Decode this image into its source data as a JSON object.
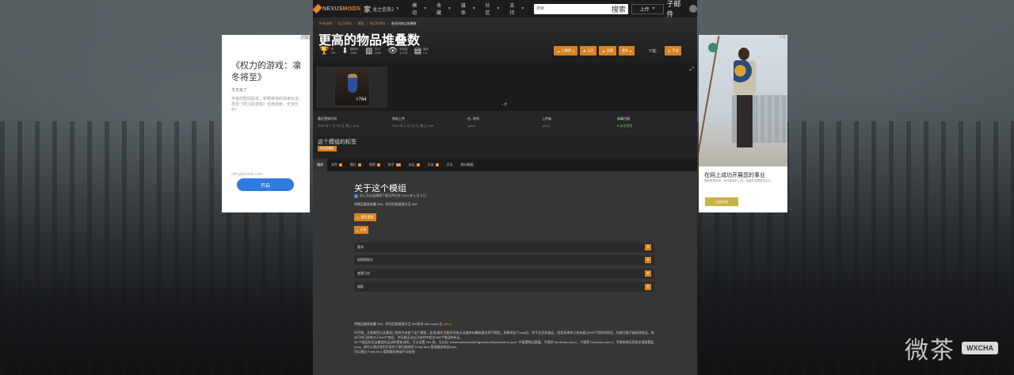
{
  "nav": {
    "logo_prefix": "NEXUS",
    "logo_suffix": "MODS",
    "game_icon": "家",
    "game_name": "龙之信条2",
    "items": [
      "模组",
      "收藏",
      "媒体",
      "社区",
      "支持"
    ],
    "search_placeholder": "搜索",
    "search_button": "搜索",
    "upload_label": "上传",
    "wx_label": "子邮件"
  },
  "mod": {
    "breadcrumb": [
      "所有游戏",
      "龙之信条2",
      "模组",
      "物品和库存",
      "更高的物品堆叠数"
    ],
    "title": "更高的物品堆叠数",
    "stats": [
      {
        "icon": "trophy-icon",
        "glyph": "🏆",
        "label": "赞",
        "value": "125"
      },
      {
        "icon": "download-icon",
        "glyph": "⬇",
        "label": "独特DL",
        "value": "4,960"
      },
      {
        "icon": "chart-icon",
        "glyph": "▥",
        "label": "总DL",
        "value": "4,800"
      },
      {
        "icon": "eye-icon",
        "glyph": "👁",
        "label": "浏览量",
        "value": "11,003"
      },
      {
        "icon": "version-icon",
        "glyph": "▤",
        "label": "版本",
        "value": "1.0"
      }
    ],
    "actions": {
      "track": "已跟踪",
      "endorse": "认可",
      "vote": "投票",
      "more": "更多",
      "download_label": "下载：",
      "manual": "手动"
    },
    "gallery_count": "1 件",
    "thumb_count": "×764",
    "info": [
      {
        "label": "最近更新时间",
        "value": "2024 年 3 月 26 日, 晚上 8:49"
      },
      {
        "label": "原始上传",
        "value": "2024 年 3 月 26 日, 晚上 8:49"
      },
      {
        "label": "由...制作",
        "value": "zydq1"
      },
      {
        "label": "上传者",
        "value": "zydq1"
      },
      {
        "label": "病毒扫描",
        "value": "安全使用"
      }
    ],
    "tags_title": "这个模组的标签",
    "tag_button": "标记此模组",
    "tabs": [
      {
        "label": "描述",
        "badge": ""
      },
      {
        "label": "文件",
        "badge": "1"
      },
      {
        "label": "图片",
        "badge": "1"
      },
      {
        "label": "视频",
        "badge": "0"
      },
      {
        "label": "帖子",
        "badge": "13"
      },
      {
        "label": "论坛",
        "badge": "0"
      },
      {
        "label": "日志",
        "badge": "0"
      },
      {
        "label": "日志",
        "badge": ""
      },
      {
        "label": "统计数据",
        "badge": ""
      }
    ]
  },
  "desc": {
    "title": "关于这个模组",
    "meta": "自上次从此模组下载文件后在 2024 年 4 月 3 日",
    "summary": "将物品最高堆叠 999，将项目数量提升至 999",
    "btn_requirements": "报告滥用",
    "btn_share": "分享",
    "accordion": [
      "要求",
      "权限和积分",
      "变更日志",
      "捐款"
    ],
    "body_1a": "将物品最高堆叠 999，将项目数量提升至 999所有 dd2 mods 在",
    "body_1b": "github",
    "body_2": "中开版。注意事项以及事项1 游戏中安装了这个模组，此项/操作可能的导致无法使库存叠装量仍然不稳定。如果你这个mod后，你不会丢失物品，但是如果你已经有超过999个相同的物品，你就可能不能拆除物品。取决于你已经有大于999个物品，你可能无法从已有的中超过999个物品的补足。",
    "body_3": "99 个物品时无法兼容时运动时更新说明。可以设置 999 即。可以在 \"reframework/data/HigherItemStackNumber.json\" 中配置物品数量。不提供 ItemData.user.2，不推荐 ItemData.user.2，不想修改玩家相关请放置此mod。请可以通过使用任意的下载功能使用 Fluffy Mod 管理器安装此mod。",
    "body_4": "可以通过 Fluffy Mod 管理器安装或手动安装"
  },
  "ad_left": {
    "mark": "广告",
    "title": "《权力的游戏：凛冬将至》",
    "sub": "冬天来了",
    "text": "丰富的剧情副本，新颖奇特的探索玩法，再现《权力的游戏》经典场景，史诗巨作！",
    "url": "clm.gtarcade.com",
    "button": "开启"
  },
  "ad_right": {
    "mark": "广告",
    "title": "在网上成功开展您的事业",
    "text": "借助简单易用、经济高效的工具，创建并发展您的企业。",
    "button": "立即开始"
  },
  "watermark": {
    "text": "微茶",
    "badge": "WXCHA"
  }
}
